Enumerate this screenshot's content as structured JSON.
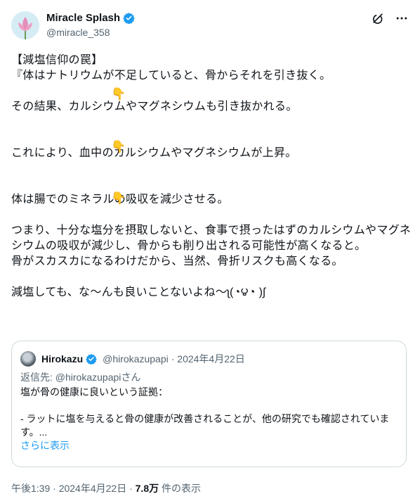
{
  "author": {
    "display_name": "Miracle Splash",
    "handle": "@miracle_358"
  },
  "tweet": {
    "body": "【減塩信仰の罠】\n『体はナトリウムが不足していると、骨からそれを引き抜く。\n\nその結果、カルシウムやマグネシウムも引き抜かれる。\n\n\nこれにより、血中のカルシウムやマグネシウムが上昇。\n\n\n体は腸でのミネラルの吸収を減少させる。\n\nつまり、十分な塩分を摂取しないと、食事で摂ったはずのカルシウムやマグネシウムの吸収が減少し、骨からも削り出される可能性が高くなると。\n骨がスカスカになるわけだから、当然、骨折リスクも高くなる。\n\n減塩しても、な〜んも良いことないよね〜ʅ(◔౪◔ )ʃ",
    "pointer_emoji": "👇"
  },
  "quote": {
    "display_name": "Hirokazu",
    "handle": "@hirokazupapi",
    "date": "· 2024年4月22日",
    "reply_label": "返信先: ",
    "reply_handle": "@hirokazupapiさん",
    "text": "塩が骨の健康に良いという証拠：\n\n- ラットに塩を与えると骨の健康が改善されることが、他の研究でも確認されています。...",
    "show_more": "さらに表示"
  },
  "footer": {
    "time": "午後1:39 · 2024年4月22日 · ",
    "views": "7.8万",
    "views_label": " 件の表示"
  },
  "icons": {
    "verified": "verified-badge-icon",
    "grok": "grok-icon",
    "more": "more-options-icon"
  },
  "colors": {
    "verified": "#1d9bf0",
    "link": "#1d9bf0",
    "secondary_text": "#536471",
    "border": "#cfd9de"
  }
}
